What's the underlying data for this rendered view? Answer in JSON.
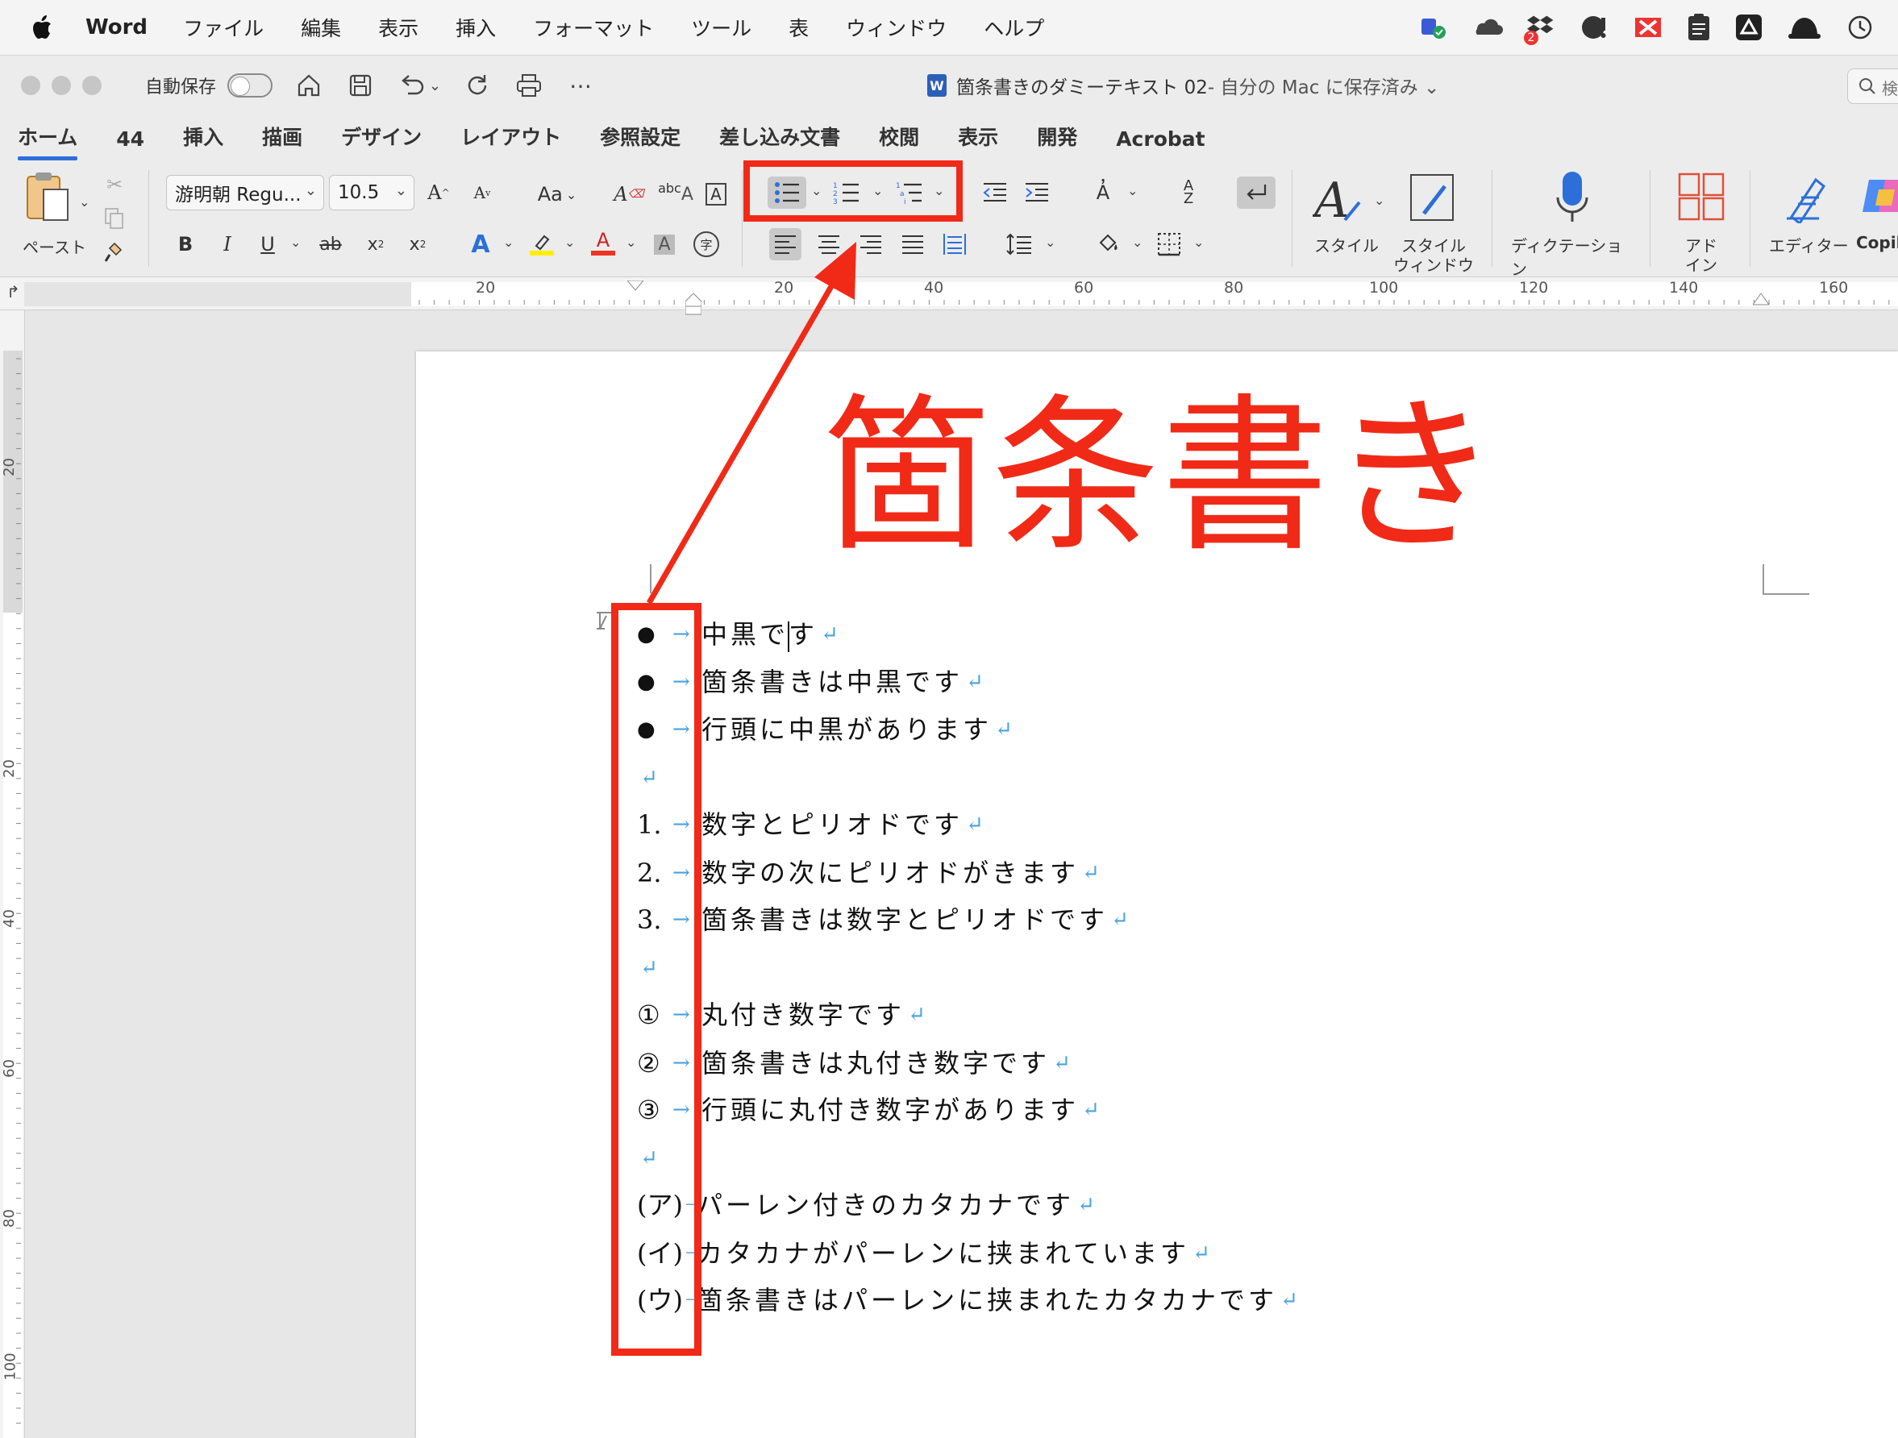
{
  "menubar": {
    "app_name": "Word",
    "items": [
      "ファイル",
      "編集",
      "表示",
      "挿入",
      "フォーマット",
      "ツール",
      "表",
      "ウィンドウ",
      "ヘルプ"
    ],
    "status_badge": "2"
  },
  "titlebar": {
    "autosave_label": "自動保存",
    "autosave_on": false,
    "doc_title": "箇条書きのダミーテキスト 02",
    "doc_status": " - 自分の Mac に保存済み ⌄",
    "search_glyph": "検"
  },
  "tabs": [
    "ホーム",
    "44",
    "挿入",
    "描画",
    "デザイン",
    "レイアウト",
    "参照設定",
    "差し込み文書",
    "校閲",
    "表示",
    "開発",
    "Acrobat"
  ],
  "active_tab": "ホーム",
  "ribbon": {
    "paste_label": "ペースト",
    "font_name": "游明朝 Regu...",
    "font_size": "10.5",
    "case_label": "Aa",
    "styles_label": "スタイル",
    "styles_pane_label_1": "スタイル",
    "styles_pane_label_2": "ウィンドウ",
    "dictation_label": "ディクテーション",
    "addin_label_1": "アド",
    "addin_label_2": "イン",
    "editor_label": "エディター",
    "copilot_label": "Copil"
  },
  "ruler": {
    "h_labels": [
      "20",
      "20",
      "40",
      "60",
      "80",
      "100",
      "120",
      "140",
      "160"
    ],
    "v_labels": [
      "20",
      "20",
      "40",
      "60",
      "80",
      "100"
    ]
  },
  "document": {
    "heading": "箇条書き",
    "lines": [
      {
        "marker": "●",
        "text": "中黒です"
      },
      {
        "marker": "●",
        "text": "箇条書きは中黒です"
      },
      {
        "marker": "●",
        "text": "行頭に中黒があります"
      },
      {
        "marker": "",
        "text": ""
      },
      {
        "marker": "1.",
        "text": "数字とピリオドです"
      },
      {
        "marker": "2.",
        "text": "数字の次にピリオドがきます"
      },
      {
        "marker": "3.",
        "text": "箇条書きは数字とピリオドです"
      },
      {
        "marker": "",
        "text": ""
      },
      {
        "marker": "①",
        "text": "丸付き数字です"
      },
      {
        "marker": "②",
        "text": "箇条書きは丸付き数字です"
      },
      {
        "marker": "③",
        "text": "行頭に丸付き数字があります"
      },
      {
        "marker": "",
        "text": ""
      },
      {
        "marker": "(ア)",
        "text": "パーレン付きのカタカナです"
      },
      {
        "marker": "(イ)",
        "text": "カタカナがパーレンに挟まれています"
      },
      {
        "marker": "(ウ)",
        "text": "箇条書きはパーレンに挟まれたカタカナです"
      }
    ]
  },
  "colors": {
    "annotation_red": "#f02a17",
    "formatting_mark_blue": "#4aa3df",
    "accent_blue": "#2d6fd8"
  }
}
